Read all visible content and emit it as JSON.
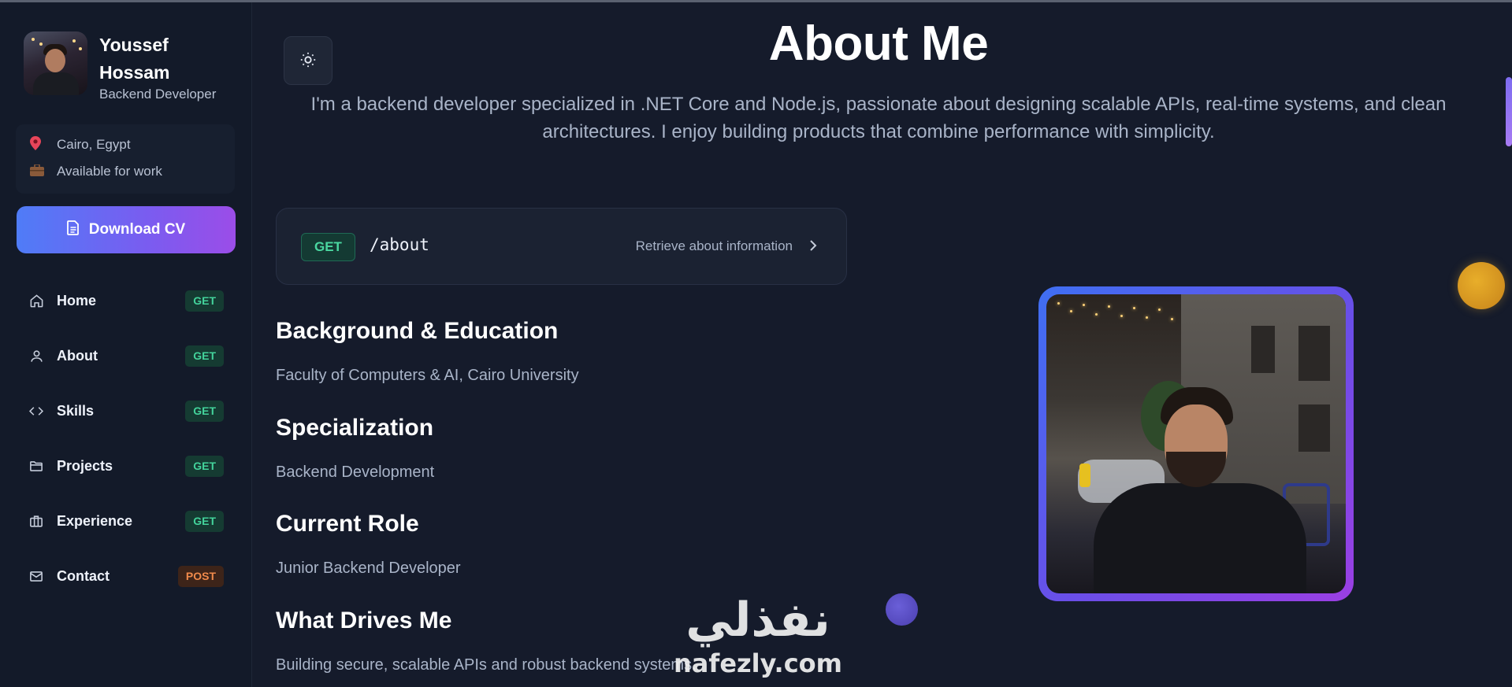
{
  "sidebar": {
    "name": "Youssef Hossam",
    "role": "Backend Developer",
    "location": "Cairo, Egypt",
    "availability": "Available for work",
    "cv_button": "Download CV",
    "nav": [
      {
        "label": "Home",
        "method": "GET",
        "icon": "home-icon"
      },
      {
        "label": "About",
        "method": "GET",
        "icon": "user-icon"
      },
      {
        "label": "Skills",
        "method": "GET",
        "icon": "code-icon"
      },
      {
        "label": "Projects",
        "method": "GET",
        "icon": "folder-icon"
      },
      {
        "label": "Experience",
        "method": "GET",
        "icon": "briefcase-icon"
      },
      {
        "label": "Contact",
        "method": "POST",
        "icon": "mail-icon"
      }
    ]
  },
  "main": {
    "title": "About Me",
    "intro": "I'm a backend developer specialized in .NET Core and Node.js, passionate about designing scalable APIs, real-time systems, and clean architectures. I enjoy building products that combine performance with simplicity.",
    "endpoint": {
      "method": "GET",
      "path": "/about",
      "description": "Retrieve about information"
    },
    "sections": [
      {
        "heading": "Background & Education",
        "text": "Faculty of Computers & AI, Cairo University"
      },
      {
        "heading": "Specialization",
        "text": "Backend Development"
      },
      {
        "heading": "Current Role",
        "text": "Junior Backend Developer"
      },
      {
        "heading": "What Drives Me",
        "text": "Building secure, scalable APIs and robust backend systems."
      }
    ]
  },
  "watermark": {
    "arabic": "نفذلي",
    "latin": "nafezly.com"
  },
  "colors": {
    "background": "#151b2b",
    "sidebar": "#131a29",
    "accent_gradient_start": "#4f7cf7",
    "accent_gradient_end": "#9b4de8",
    "get_badge": "#43d39b",
    "post_badge": "#f08a4b"
  }
}
